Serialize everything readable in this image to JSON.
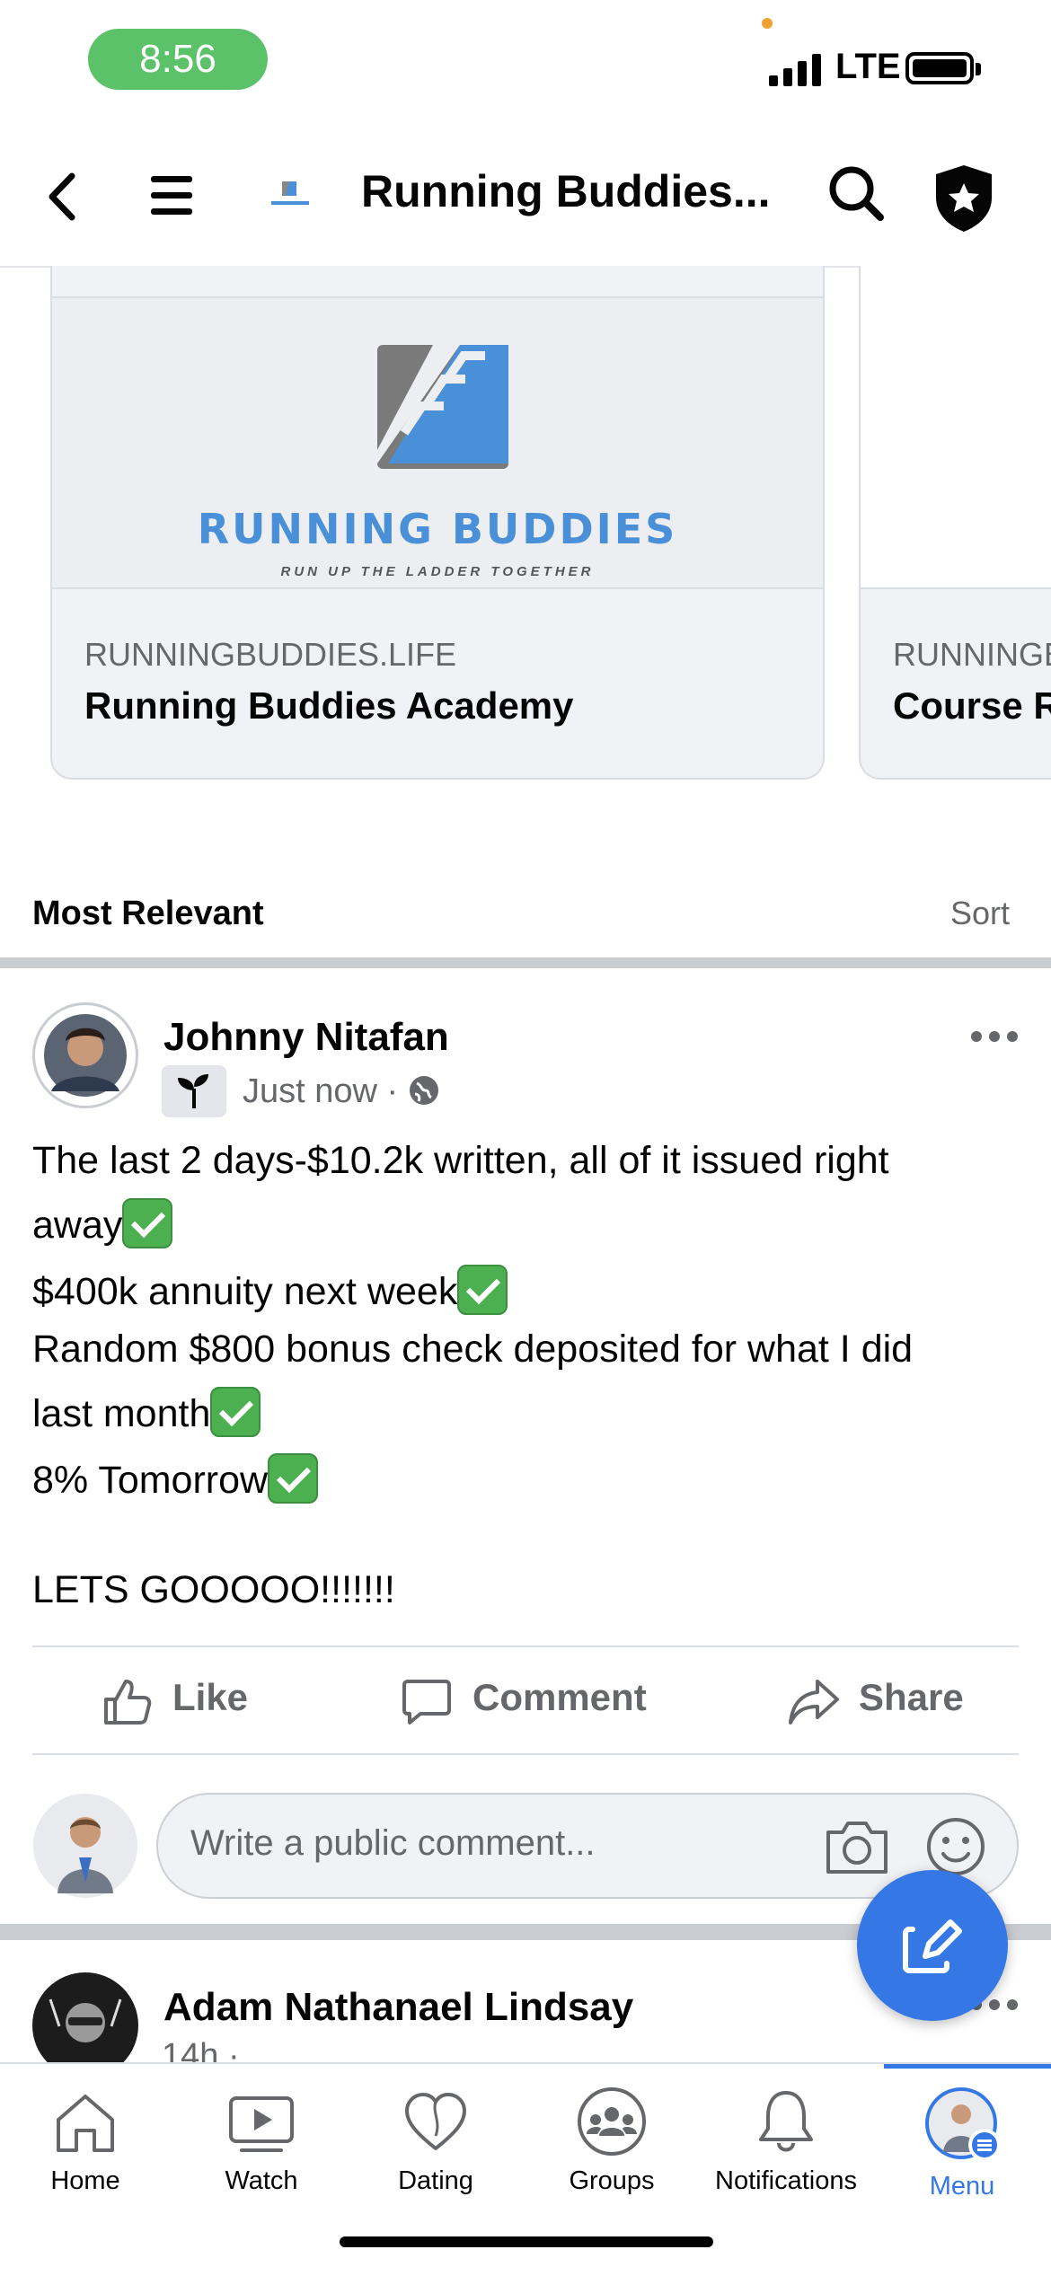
{
  "status_bar": {
    "time": "8:56",
    "network": "LTE"
  },
  "header": {
    "title": "Running Buddies..."
  },
  "link_previews": [
    {
      "logo_text": "RUNNING BUDDIES",
      "logo_tagline": "RUN UP THE LADDER TOGETHER",
      "domain": "RUNNINGBUDDIES.LIFE",
      "title": "Running Buddies Academy"
    },
    {
      "domain": "RUNNINGB",
      "title": "Course R"
    }
  ],
  "comments_header": {
    "label": "Most Relevant",
    "sort_label": "Sort"
  },
  "post": {
    "author": "Johnny Nitafan",
    "time": "Just now · ",
    "lines": [
      "The last 2 days-$10.2k written, all of it issued right",
      "away",
      "$400k annuity next week",
      "Random $800 bonus check deposited for what I did",
      "last month",
      "8% Tomorrow",
      "LETS GOOOOO!!!!!!!"
    ],
    "actions": {
      "like": "Like",
      "comment": "Comment",
      "share": "Share"
    },
    "comment_placeholder": "Write a public comment..."
  },
  "next_post": {
    "author": "Adam Nathanael Lindsay",
    "time": "14h ·"
  },
  "tab_bar": {
    "items": [
      {
        "label": "Home",
        "icon": "home-icon"
      },
      {
        "label": "Watch",
        "icon": "watch-icon"
      },
      {
        "label": "Dating",
        "icon": "dating-icon"
      },
      {
        "label": "Groups",
        "icon": "groups-icon"
      },
      {
        "label": "Notifications",
        "icon": "bell-icon"
      },
      {
        "label": "Menu",
        "icon": "menu-avatar-icon"
      }
    ],
    "active": "Menu"
  },
  "colors": {
    "accent": "#3578e5",
    "status_pill": "#5cc26a",
    "divider": "#c9ccd1",
    "text_secondary": "#65676b"
  }
}
